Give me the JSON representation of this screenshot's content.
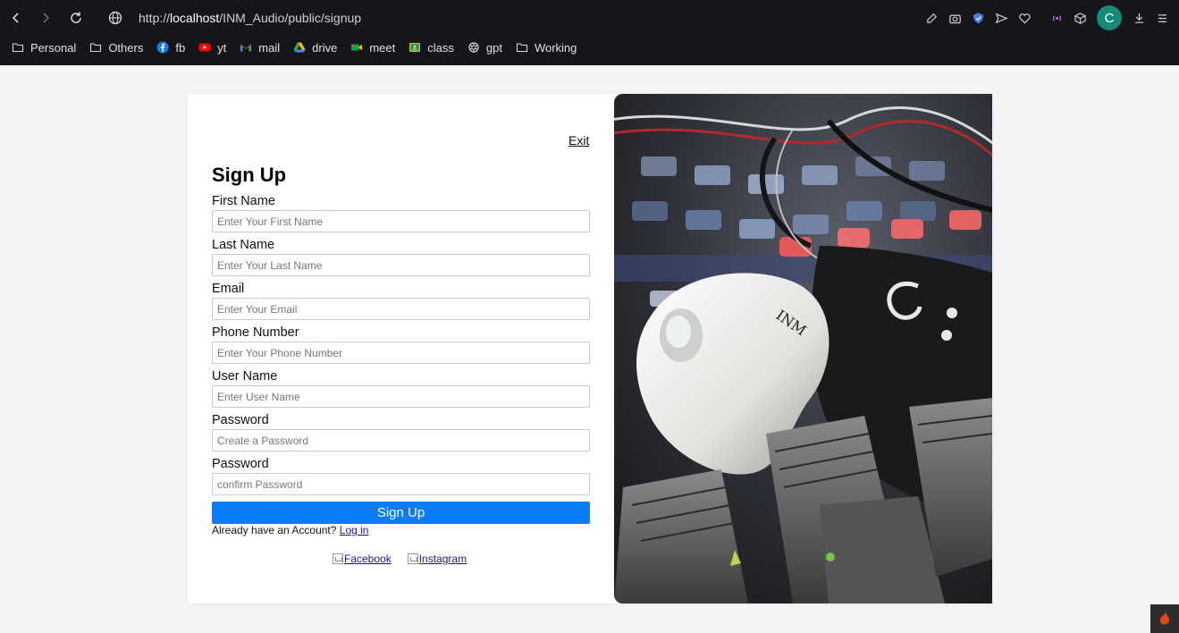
{
  "browser": {
    "url_prefix": "http://",
    "url_host": "localhost",
    "url_path": "/INM_Audio/public/signup",
    "avatar_letter": "C",
    "accent": "#138a7a",
    "bookmarks": [
      {
        "label": "Personal",
        "icon": "folder-icon"
      },
      {
        "label": "Others",
        "icon": "folder-icon"
      },
      {
        "label": "fb",
        "icon": "facebook-icon"
      },
      {
        "label": "yt",
        "icon": "youtube-icon"
      },
      {
        "label": "mail",
        "icon": "gmail-icon"
      },
      {
        "label": "drive",
        "icon": "drive-icon"
      },
      {
        "label": "meet",
        "icon": "meet-icon"
      },
      {
        "label": "class",
        "icon": "classroom-icon"
      },
      {
        "label": "gpt",
        "icon": "openai-icon"
      },
      {
        "label": "Working",
        "icon": "folder-icon"
      }
    ]
  },
  "signup": {
    "exit_label": "Exit",
    "title": "Sign Up",
    "fields": [
      {
        "label": "First Name",
        "placeholder": "Enter Your First Name",
        "value": ""
      },
      {
        "label": "Last Name",
        "placeholder": "Enter Your Last Name",
        "value": ""
      },
      {
        "label": "Email",
        "placeholder": "Enter Your Email",
        "value": ""
      },
      {
        "label": "Phone Number",
        "placeholder": "Enter Your Phone Number",
        "value": ""
      },
      {
        "label": "User Name",
        "placeholder": "Enter User Name",
        "value": ""
      },
      {
        "label": "Password",
        "placeholder": "Create a Password",
        "value": ""
      },
      {
        "label": "Password",
        "placeholder": "confirm Password",
        "value": ""
      }
    ],
    "submit_label": "Sign Up",
    "submit_color": "#0a7cfc",
    "login_prompt": "Already have an Account?",
    "login_link": "Log in",
    "socials": [
      {
        "label": "Facebook"
      },
      {
        "label": "Instagram"
      }
    ],
    "image_logo_text": "INM"
  }
}
